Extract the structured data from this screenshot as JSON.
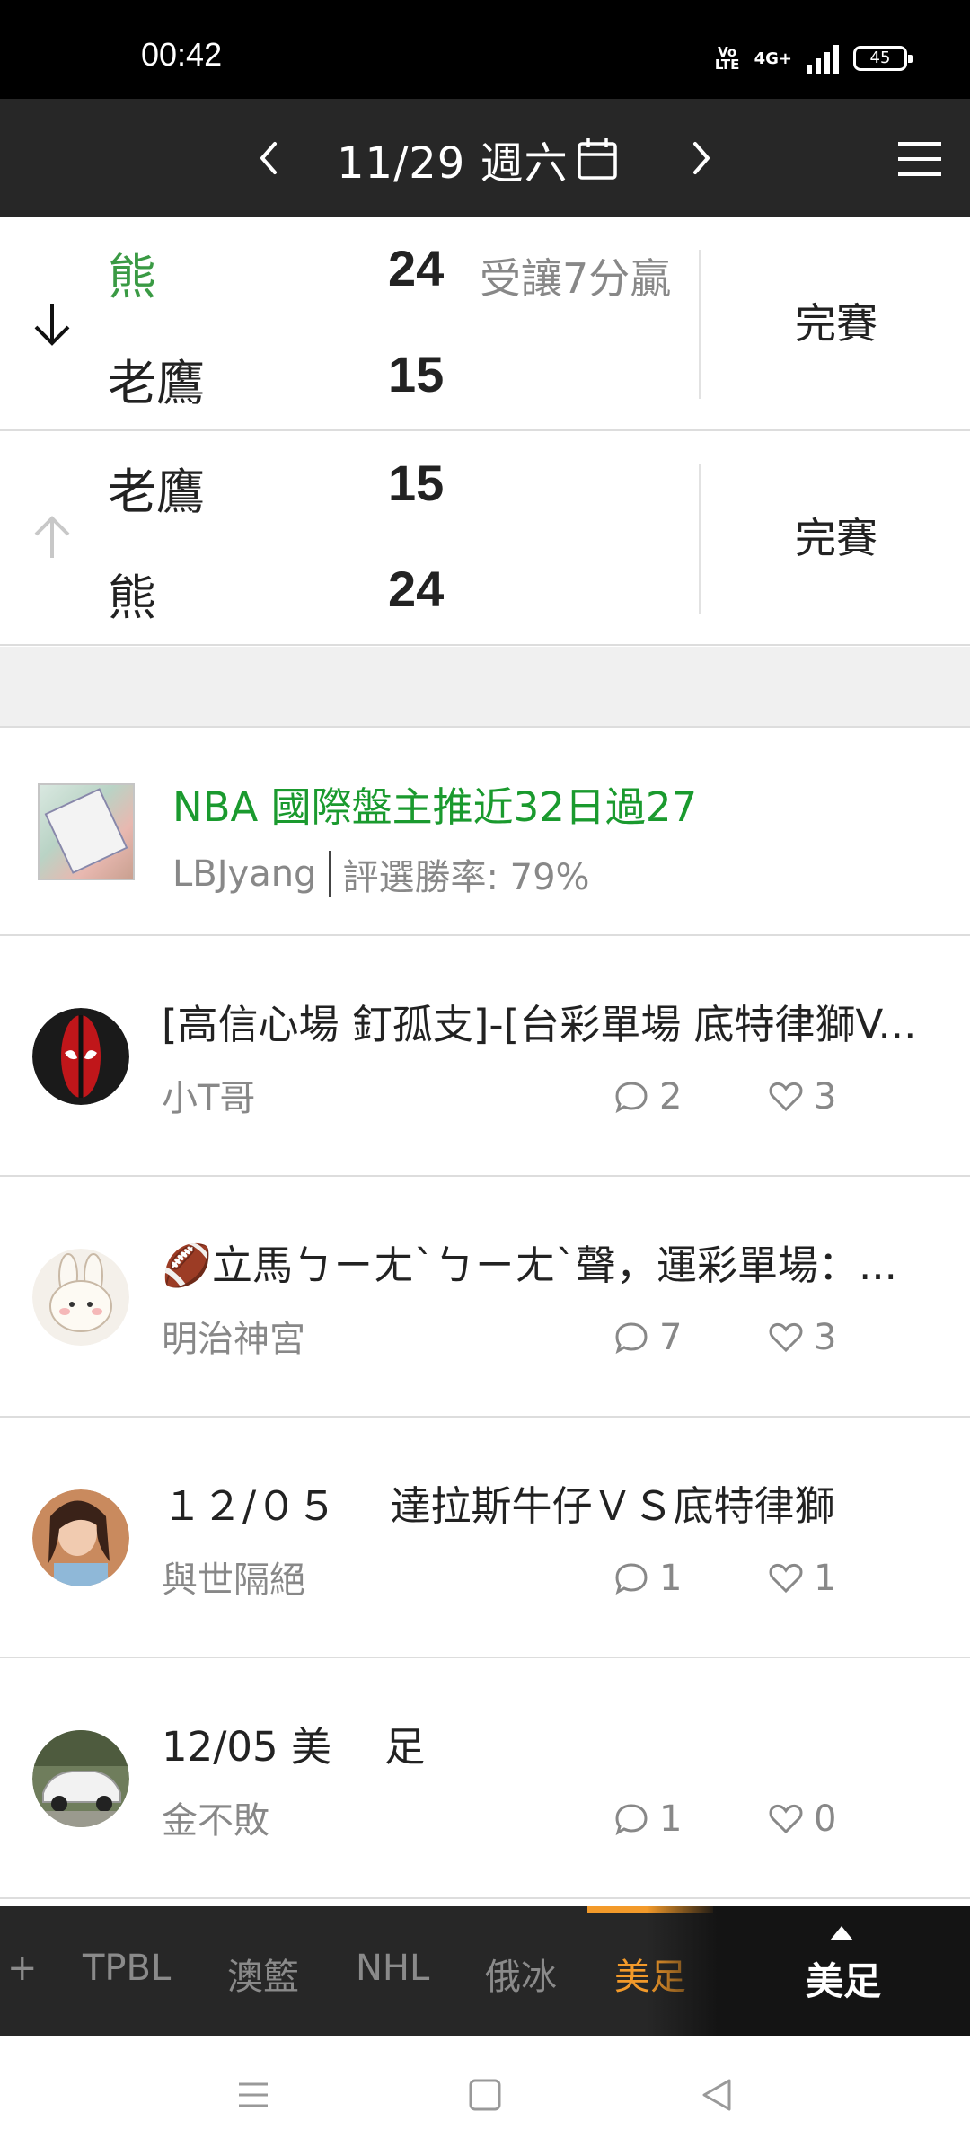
{
  "status_bar": {
    "time": "00:42",
    "volte": "Vo\nLTE",
    "network": "4G+",
    "battery": "45"
  },
  "header": {
    "date": "11/29 週六"
  },
  "matches": [
    {
      "top_team": "熊",
      "top_score": "24",
      "top_note": "受讓7分贏",
      "bottom_team": "老鷹",
      "bottom_score": "15",
      "status": "完賽"
    },
    {
      "top_team": "老鷹",
      "top_score": "15",
      "bottom_team": "熊",
      "bottom_score": "24",
      "status": "完賽"
    }
  ],
  "feature_post": {
    "title": "NBA 國際盤主推近32日過27",
    "author": "LBJyang",
    "win_rate": "評選勝率: 79%"
  },
  "posts": [
    {
      "title": "[高信心場 釘孤支]-[台彩單場 底特律獅V...",
      "author": "小T哥",
      "comments": "2",
      "likes": "3"
    },
    {
      "title": "🏈立馬ㄅㄧㄤˋㄅㄧㄤˋ聲，運彩單場：...",
      "author": "明治神宮",
      "comments": "7",
      "likes": "3"
    },
    {
      "title": "１２/０５　 達拉斯牛仔ＶＳ底特律獅",
      "author": "與世隔絕",
      "comments": "1",
      "likes": "1"
    },
    {
      "title": "12/05   美　 足",
      "author": "金不敗",
      "comments": "1",
      "likes": "0"
    }
  ],
  "tabs": {
    "items": [
      "+",
      "TPBL",
      "澳籃",
      "NHL",
      "俄冰",
      "美足"
    ],
    "active": "美足",
    "current": "美足"
  },
  "colors": {
    "accent_green": "#1a9a2e",
    "accent_orange": "#f39a2a",
    "header_bg": "#272727"
  }
}
